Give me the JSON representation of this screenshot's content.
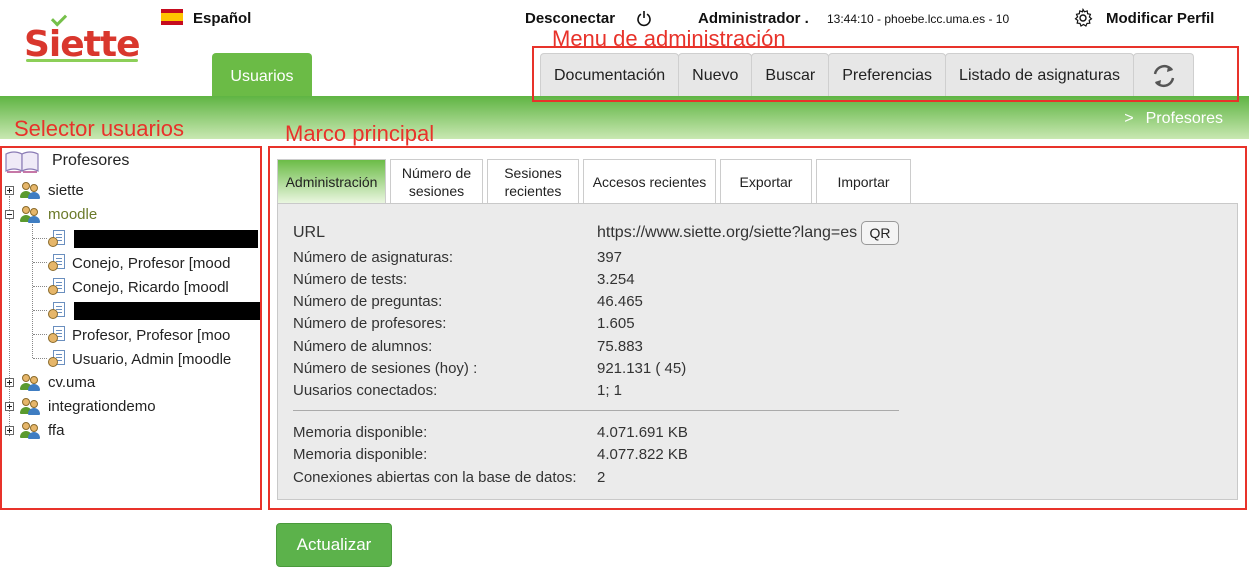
{
  "header": {
    "logo_text": "Siette",
    "language": "Español",
    "disconnect_label": "Desconectar",
    "admin_name": "Administrador .",
    "server_info": "13:44:10 - phoebe.lcc.uma.es - 10",
    "profile_label": "Modificar Perfil",
    "main_tab": "Usuarios"
  },
  "admin_menu": {
    "items": [
      "Documentación",
      "Nuevo",
      "Buscar",
      "Preferencias",
      "Listado de asignaturas"
    ]
  },
  "breadcrumb": {
    "separator": ">",
    "current": "Profesores"
  },
  "annotations": {
    "menu": "Menu de administración",
    "selector": "Selector usuarios",
    "main": "Marco principal"
  },
  "tree": {
    "root": "Profesores",
    "groups": {
      "siette": "siette",
      "moodle": "moodle",
      "cvuma": "cv.uma",
      "integrationdemo": "integrationdemo",
      "ffa": "ffa"
    },
    "moodle_users": [
      "Conejo, Profesor [mood",
      "Conejo, Ricardo [moodl",
      "Profesor, Profesor [moo",
      "Usuario, Admin [moodle"
    ]
  },
  "tabs": [
    "Administración",
    "Número de\nsesiones",
    "Sesiones\nrecientes",
    "Accesos recientes",
    "Exportar",
    "Importar"
  ],
  "info": {
    "rows": [
      {
        "label": "URL",
        "value": "https://www.siette.org/siette?lang=es"
      },
      {
        "label": "Número de asignaturas:",
        "value": "397"
      },
      {
        "label": "Número de tests:",
        "value": "3.254"
      },
      {
        "label": "Número de preguntas:",
        "value": "46.465"
      },
      {
        "label": "Número de profesores:",
        "value": "1.605"
      },
      {
        "label": "Número de alumnos:",
        "value": "75.883"
      },
      {
        "label": "Número de sesiones (hoy) :",
        "value": "921.131 ( 45)"
      },
      {
        "label": "Uusarios conectados:",
        "value": "1; 1"
      },
      {
        "label": "Memoria disponible:",
        "value": "4.071.691 KB"
      },
      {
        "label": "Memoria disponible:",
        "value": "4.077.822 KB"
      },
      {
        "label": "Conexiones abiertas con la base de datos:",
        "value": "2"
      }
    ],
    "qr_label": "QR"
  },
  "update_button": "Actualizar"
}
